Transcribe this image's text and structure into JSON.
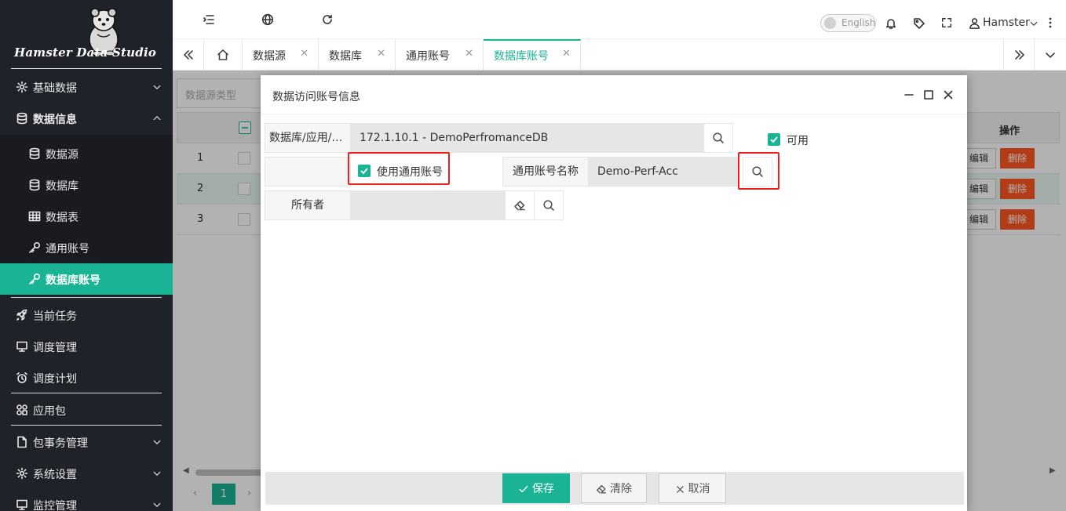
{
  "app": {
    "logo_text": "Hamster Data Studio"
  },
  "sidebar": {
    "items": [
      {
        "label": "基础数据",
        "icon": "gear-icon"
      },
      {
        "label": "数据信息",
        "icon": "database-icon"
      },
      {
        "label": "数据源",
        "icon": "database-icon"
      },
      {
        "label": "数据库",
        "icon": "database-icon"
      },
      {
        "label": "数据表",
        "icon": "table-icon"
      },
      {
        "label": "通用账号",
        "icon": "key-icon"
      },
      {
        "label": "数据库账号",
        "icon": "key-icon"
      },
      {
        "label": "当前任务",
        "icon": "rocket-icon"
      },
      {
        "label": "调度管理",
        "icon": "monitor-icon"
      },
      {
        "label": "调度计划",
        "icon": "alarm-icon"
      },
      {
        "label": "应用包",
        "icon": "apps-icon"
      },
      {
        "label": "包事务管理",
        "icon": "file-icon"
      },
      {
        "label": "系统设置",
        "icon": "gear-icon"
      },
      {
        "label": "监控管理",
        "icon": "monitor-icon"
      }
    ]
  },
  "topbar": {
    "lang": "English",
    "user": "Hamster"
  },
  "tabs": [
    {
      "label": "数据源"
    },
    {
      "label": "数据库"
    },
    {
      "label": "通用账号"
    },
    {
      "label": "数据库账号"
    }
  ],
  "list": {
    "filter_placeholder": "数据源类型",
    "header_action": "操作",
    "rows": [
      {
        "no": "1",
        "edit": "编辑",
        "delete": "删除"
      },
      {
        "no": "2",
        "edit": "编辑",
        "delete": "删除"
      },
      {
        "no": "3",
        "edit": "编辑",
        "delete": "删除"
      }
    ],
    "page": "1"
  },
  "dialog": {
    "title": "数据访问账号信息",
    "db_label": "数据库/应用/…",
    "db_value": "172.1.10.1 - DemoPerfromanceDB",
    "enabled_label": "可用",
    "use_common_label": "使用通用账号",
    "common_name_label": "通用账号名称",
    "common_name_value": "Demo-Perf-Acc",
    "owner_label": "所有者",
    "owner_value": "",
    "save": "保存",
    "clear": "清除",
    "cancel": "取消"
  },
  "colors": {
    "accent": "#1ab394",
    "sidebar_bg": "#20222a",
    "danger": "#ff5722",
    "highlight": "#e8231f"
  }
}
